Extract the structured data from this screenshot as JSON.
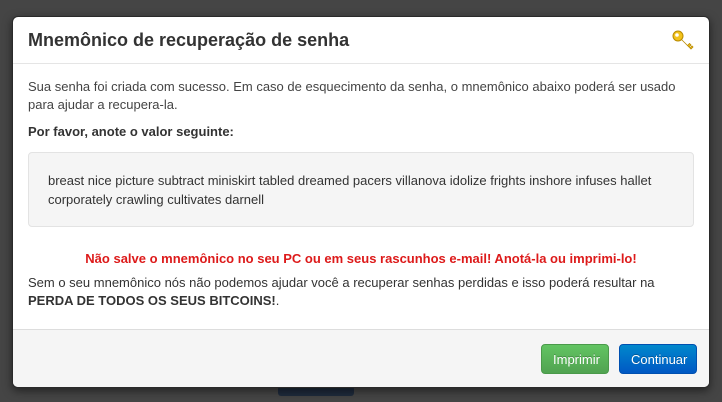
{
  "modal": {
    "title": "Mnemônico de recuperação de senha",
    "header_icon": "key-icon",
    "intro": "Sua senha foi criada com sucesso. Em caso de esquecimento da senha, o mnemônico abaixo poderá ser usado para ajudar a recupera-la.",
    "instruction": "Por favor, anote o valor seguinte:",
    "mnemonic": "breast nice picture subtract miniskirt tabled dreamed pacers villanova idolize frights inshore infuses hallet corporately crawling cultivates darnell",
    "warning": "Não salve o mnemônico no seu PC ou em seus rascunhos e-mail! Anotá-la ou imprimi-lo!",
    "closing_text": "Sem o seu mnemônico nós não podemos ajudar você a recuperar senhas perdidas e isso poderá resultar na ",
    "closing_emphasis": "PERDA DE TODOS OS SEUS BITCOINS!",
    "closing_end": "."
  },
  "footer": {
    "print_label": "Imprimir",
    "continue_label": "Continuar"
  },
  "colors": {
    "warning": "#dd1a1a",
    "print_button": "#5bb75b",
    "continue_button": "#006dcc"
  }
}
